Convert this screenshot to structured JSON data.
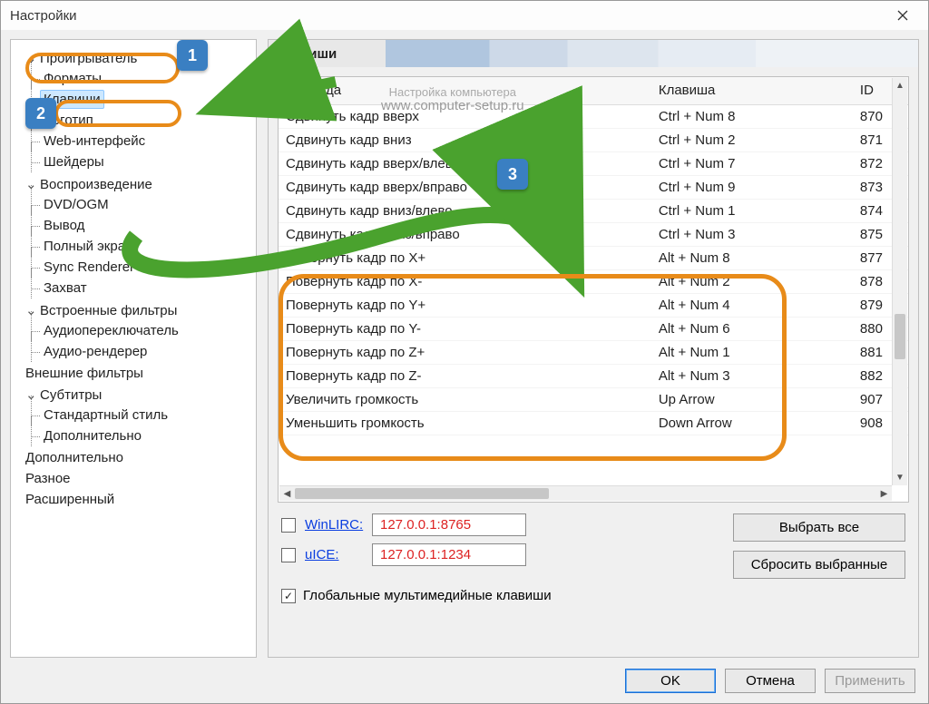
{
  "window": {
    "title": "Настройки"
  },
  "watermark": {
    "line1": "Настройка компьютера",
    "line2": "www.computer-setup.ru"
  },
  "tree": {
    "n0": "Проигрыватель",
    "n0_0": "Форматы",
    "n0_1": "Клавиши",
    "n0_2": "Логотип",
    "n0_3": "Web-интерфейс",
    "n0_4": "Шейдеры",
    "n1": "Воспроизведение",
    "n1_0": "DVD/OGM",
    "n1_1": "Вывод",
    "n1_2": "Полный экран",
    "n1_3": "Sync Renderer",
    "n1_4": "Захват",
    "n2": "Встроенные фильтры",
    "n2_0": "Аудиопереключатель",
    "n2_1": "Аудио-рендерер",
    "n3": "Внешние фильтры",
    "n4": "Субтитры",
    "n4_0": "Стандартный стиль",
    "n4_1": "Дополнительно",
    "n5": "Дополнительно",
    "n6": "Разное",
    "n7": "Расширенный"
  },
  "panel": {
    "header": "Клавиши",
    "cols": {
      "cmd": "Команда",
      "key": "Клавиша",
      "id": "ID"
    }
  },
  "rows": [
    {
      "cmd": "Сдвинуть кадр вверх",
      "key": "Ctrl + Num 8",
      "id": "870"
    },
    {
      "cmd": "Сдвинуть кадр вниз",
      "key": "Ctrl + Num 2",
      "id": "871"
    },
    {
      "cmd": "Сдвинуть кадр вверх/влево",
      "key": "Ctrl + Num 7",
      "id": "872"
    },
    {
      "cmd": "Сдвинуть кадр вверх/вправо",
      "key": "Ctrl + Num 9",
      "id": "873"
    },
    {
      "cmd": "Сдвинуть кадр вниз/влево",
      "key": "Ctrl + Num 1",
      "id": "874"
    },
    {
      "cmd": "Сдвинуть кадр вниз/вправо",
      "key": "Ctrl + Num 3",
      "id": "875"
    },
    {
      "cmd": "Повернуть кадр по X+",
      "key": "Alt + Num 8",
      "id": "877"
    },
    {
      "cmd": "Повернуть кадр по X-",
      "key": "Alt + Num 2",
      "id": "878"
    },
    {
      "cmd": "Повернуть кадр по Y+",
      "key": "Alt + Num 4",
      "id": "879"
    },
    {
      "cmd": "Повернуть кадр по Y-",
      "key": "Alt + Num 6",
      "id": "880"
    },
    {
      "cmd": "Повернуть кадр по Z+",
      "key": "Alt + Num 1",
      "id": "881"
    },
    {
      "cmd": "Повернуть кадр по Z-",
      "key": "Alt + Num 3",
      "id": "882"
    },
    {
      "cmd": "Увеличить громкость",
      "key": "Up Arrow",
      "id": "907"
    },
    {
      "cmd": "Уменьшить громкость",
      "key": "Down Arrow",
      "id": "908"
    }
  ],
  "remote": {
    "winlirc_label": "WinLIRC:",
    "winlirc_addr": "127.0.0.1:8765",
    "uice_label": "uICE:",
    "uice_addr": "127.0.0.1:1234",
    "global": "Глобальные мультимедийные клавиши"
  },
  "buttons": {
    "select_all": "Выбрать все",
    "reset_sel": "Сбросить выбранные",
    "ok": "OK",
    "cancel": "Отмена",
    "apply": "Применить"
  },
  "anno": {
    "b1": "1",
    "b2": "2",
    "b3": "3"
  }
}
